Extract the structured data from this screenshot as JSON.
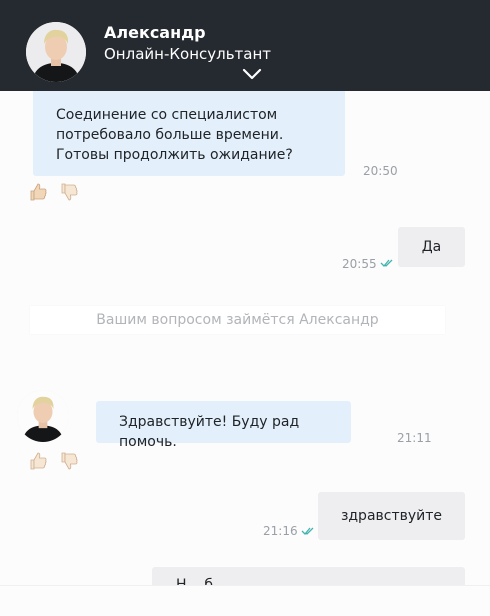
{
  "header": {
    "name": "Александр",
    "subtitle": "Онлайн-Консультант",
    "avatar_icon": "operator-avatar-icon",
    "collapse_icon": "chevron-down-icon"
  },
  "messages": [
    {
      "direction": "incoming",
      "lines": [
        "Соединение со специалистом",
        "потребовало больше времени.",
        "Готовы продолжить ожидание?"
      ],
      "time": "20:50",
      "rating_icons": [
        "thumbs-up-icon",
        "thumbs-down-icon"
      ]
    },
    {
      "direction": "outgoing",
      "text": "Да",
      "time": "20:55",
      "status_icon": "double-check-icon"
    },
    {
      "direction": "system",
      "text": "Вашим вопросом займётся Александр"
    },
    {
      "direction": "incoming",
      "text": "Здравствуйте! Буду рад помочь.",
      "time": "21:11",
      "rating_icons": [
        "thumbs-up-icon",
        "thumbs-down-icon"
      ]
    },
    {
      "direction": "outgoing",
      "text": "здравствуйте",
      "time": "21:16",
      "status_icon": "double-check-icon"
    },
    {
      "direction": "outgoing",
      "text": "Н... б...",
      "partial": true
    }
  ],
  "colors": {
    "header_bg": "#252a31",
    "incoming_bubble": "#e3f0fb",
    "outgoing_bubble": "#eeeef0",
    "read_check": "#41b4b0",
    "thumb_fill": "#f1d7b8"
  }
}
